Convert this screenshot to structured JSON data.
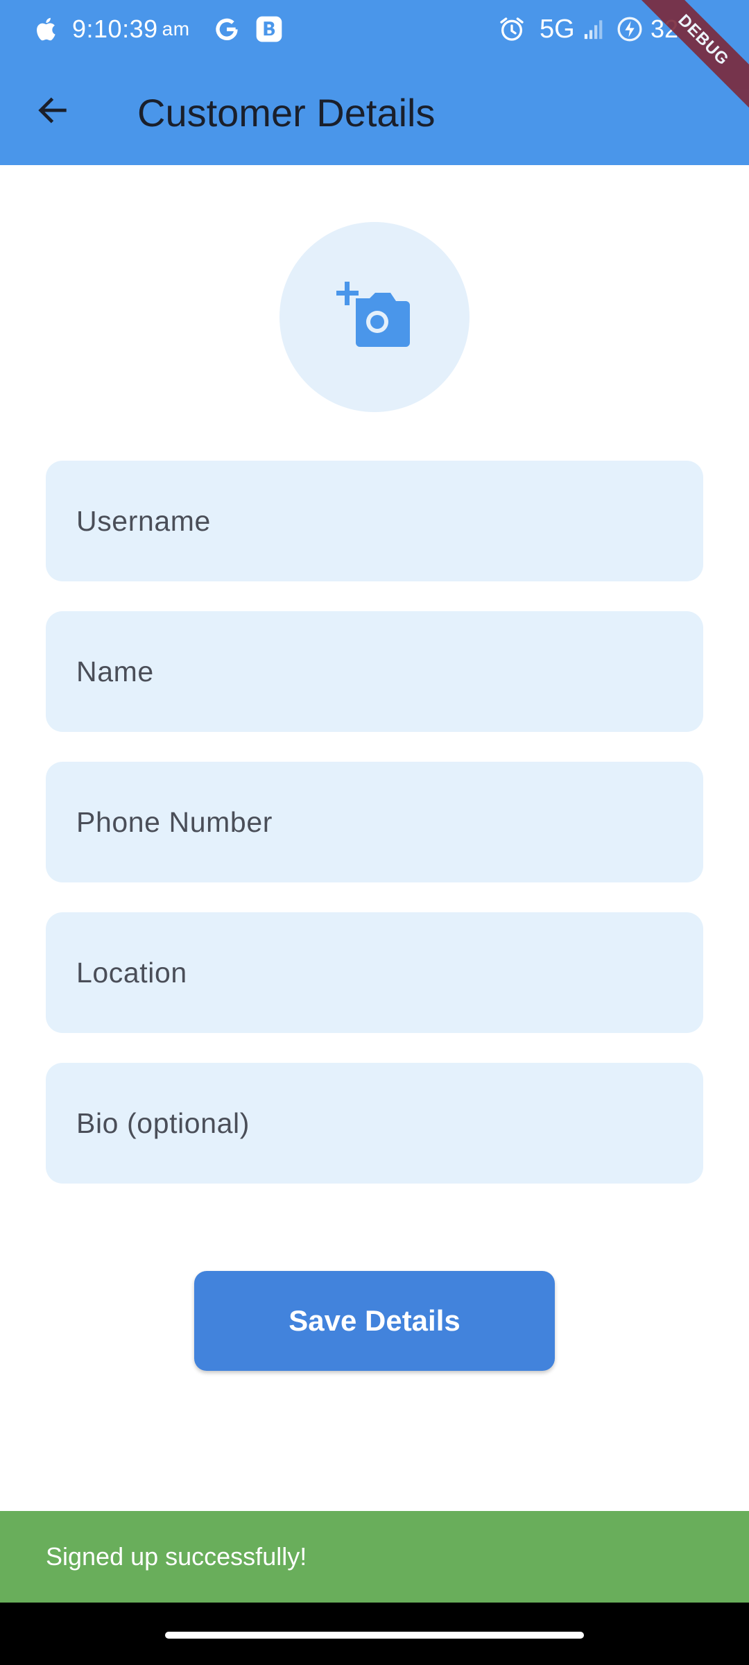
{
  "status_bar": {
    "time": "9:10:39",
    "am_pm": "am",
    "network": "5G",
    "battery": "32"
  },
  "debug_banner": "DEBUG",
  "app_bar": {
    "title": "Customer Details"
  },
  "form": {
    "username": {
      "placeholder": "Username",
      "value": ""
    },
    "name": {
      "placeholder": "Name",
      "value": ""
    },
    "phone": {
      "placeholder": "Phone Number",
      "value": ""
    },
    "location": {
      "placeholder": "Location",
      "value": ""
    },
    "bio": {
      "placeholder": "Bio (optional)",
      "value": ""
    }
  },
  "save_button": {
    "label": "Save Details"
  },
  "snackbar": {
    "message": "Signed up successfully!"
  },
  "colors": {
    "app_bar": "#4a96ea",
    "field_fill": "#e4f1fc",
    "button": "#4283dc",
    "snackbar": "#69ae5b",
    "debug_ribbon": "#7b2a3c"
  },
  "icons": {
    "back": "arrow-back-icon",
    "avatar": "add-a-photo-icon",
    "status": [
      "apple-icon",
      "google-icon",
      "b-app-icon",
      "alarm-icon",
      "signal-icon",
      "battery-charging-icon"
    ]
  }
}
